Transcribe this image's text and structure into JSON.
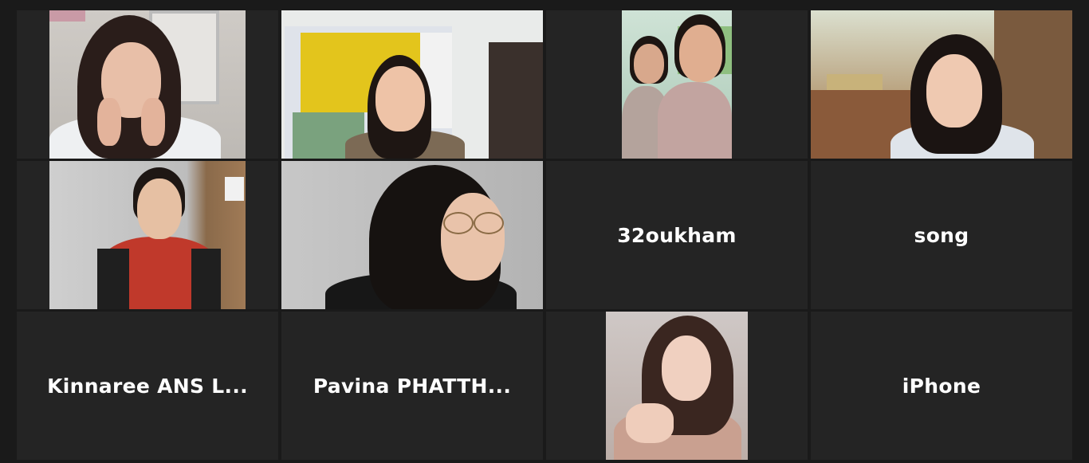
{
  "meeting": {
    "participants": [
      {
        "name": "",
        "video": true,
        "active": false
      },
      {
        "name": "",
        "video": true,
        "active": true
      },
      {
        "name": "",
        "video": true,
        "active": false
      },
      {
        "name": "",
        "video": true,
        "active": false
      },
      {
        "name": "",
        "video": true,
        "active": false
      },
      {
        "name": "",
        "video": true,
        "active": false
      },
      {
        "name": "32oukham",
        "video": false,
        "active": false
      },
      {
        "name": "song",
        "video": false,
        "active": false
      },
      {
        "name": "Kinnaree ANS L...",
        "video": false,
        "active": false
      },
      {
        "name": "Pavina PHATTH...",
        "video": false,
        "active": false
      },
      {
        "name": "",
        "video": true,
        "active": false
      },
      {
        "name": "iPhone",
        "video": false,
        "active": false
      }
    ]
  },
  "colors": {
    "background": "#1a1a1a",
    "tile": "#242424",
    "active_speaker_border": "#e2e86f",
    "name_text": "#ffffff"
  }
}
